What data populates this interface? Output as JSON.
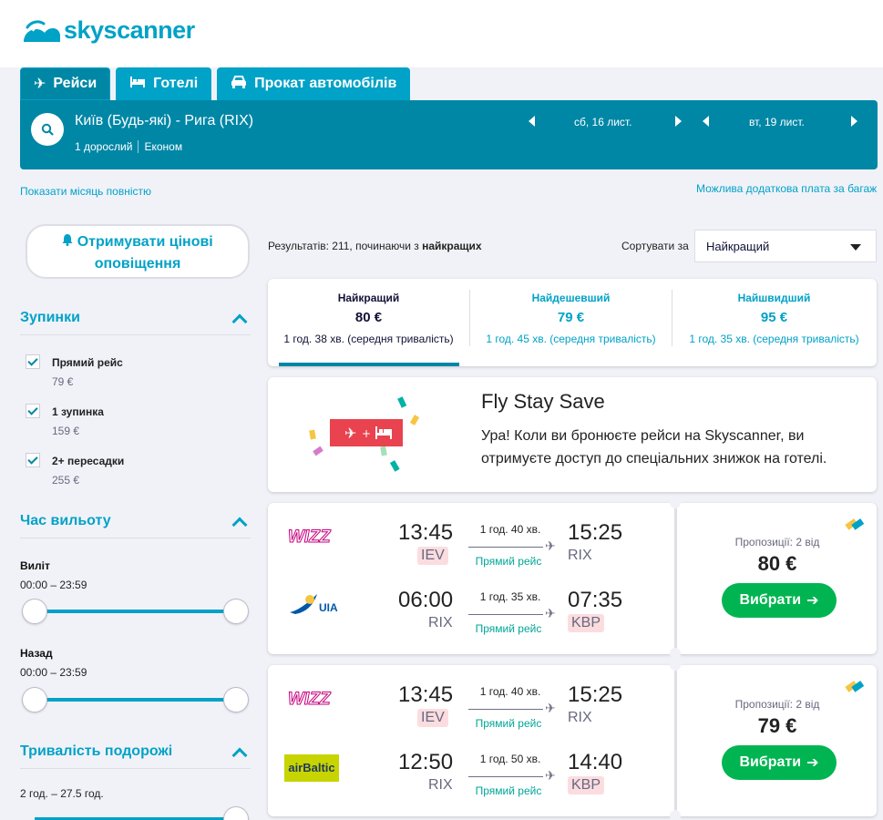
{
  "brand": {
    "name": "skyscanner",
    "color": "#00a2c7"
  },
  "tabs": [
    {
      "label": "Рейси",
      "icon": "plane-icon",
      "active": true
    },
    {
      "label": "Готелі",
      "icon": "bed-icon",
      "active": false
    },
    {
      "label": "Прокат автомобілів",
      "icon": "car-icon",
      "active": false
    }
  ],
  "search": {
    "route": "Київ (Будь-які) - Рига (RIX)",
    "passengers": "1 дорослий",
    "cabin": "Економ",
    "depart_date": "сб, 16 лист.",
    "return_date": "вт, 19 лист."
  },
  "links": {
    "show_month": "Показати місяць повністю",
    "baggage": "Можлива додаткова плата за багаж"
  },
  "sidebar": {
    "alert_button": "Отримувати цінові оповіщення",
    "stops": {
      "title": "Зупинки",
      "options": [
        {
          "label": "Прямий рейс",
          "price": "79 €",
          "checked": true
        },
        {
          "label": "1 зупинка",
          "price": "159 €",
          "checked": true
        },
        {
          "label": "2+ пересадки",
          "price": "255 €",
          "checked": true
        }
      ]
    },
    "departure_time": {
      "title": "Час вильоту",
      "outbound_label": "Виліт",
      "outbound_range": "00:00 – 23:59",
      "return_label": "Назад",
      "return_range": "00:00 – 23:59"
    },
    "duration": {
      "title": "Тривалість подорожі",
      "range": "2 год. – 27.5 год."
    }
  },
  "results": {
    "count_prefix": "Результатів: 211, починаючи з ",
    "count_bold": "найкращих",
    "sort_label": "Сортувати за",
    "sort_value": "Найкращий",
    "sort_tabs": [
      {
        "title": "Найкращий",
        "price": "80 €",
        "duration": "1 год. 38 хв. (середня тривалість)",
        "active": true
      },
      {
        "title": "Найдешевший",
        "price": "79 €",
        "duration": "1 год. 45 хв. (середня тривалість)",
        "active": false
      },
      {
        "title": "Найшвидший",
        "price": "95 €",
        "duration": "1 год. 35 хв. (середня тривалість)",
        "active": false
      }
    ]
  },
  "promo": {
    "title": "Fly Stay Save",
    "text": "Ура! Коли ви бронюєте рейси на Skyscanner, ви отримуєте доступ до спеціальних знижок на готелі."
  },
  "flights": [
    {
      "legs": [
        {
          "airline": "wizz",
          "dep_time": "13:45",
          "dep_code": "IEV",
          "dep_hl": true,
          "duration": "1 год. 40 хв.",
          "stops": "Прямий рейс",
          "arr_time": "15:25",
          "arr_code": "RIX",
          "arr_hl": false
        },
        {
          "airline": "UIA",
          "dep_time": "06:00",
          "dep_code": "RIX",
          "dep_hl": false,
          "duration": "1 год. 35 хв.",
          "stops": "Прямий рейс",
          "arr_time": "07:35",
          "arr_code": "KBP",
          "arr_hl": true
        }
      ],
      "offers": "Пропозиції: 2 від",
      "price": "80 €",
      "button": "Вибрати"
    },
    {
      "legs": [
        {
          "airline": "wizz",
          "dep_time": "13:45",
          "dep_code": "IEV",
          "dep_hl": true,
          "duration": "1 год. 40 хв.",
          "stops": "Прямий рейс",
          "arr_time": "15:25",
          "arr_code": "RIX",
          "arr_hl": false
        },
        {
          "airline": "airBaltic",
          "dep_time": "12:50",
          "dep_code": "RIX",
          "dep_hl": false,
          "duration": "1 год. 50 хв.",
          "stops": "Прямий рейс",
          "arr_time": "14:40",
          "arr_code": "KBP",
          "arr_hl": true
        }
      ],
      "offers": "Пропозиції: 2 від",
      "price": "79 €",
      "button": "Вибрати"
    }
  ],
  "airline_names": {
    "wizz": "WIZZ",
    "uia": "UIA",
    "airbaltic": "airBaltic"
  },
  "colors": {
    "primary": "#00a2c7",
    "dark_primary": "#0087a6",
    "green": "#00b551",
    "highlight": "#fbdde0"
  }
}
